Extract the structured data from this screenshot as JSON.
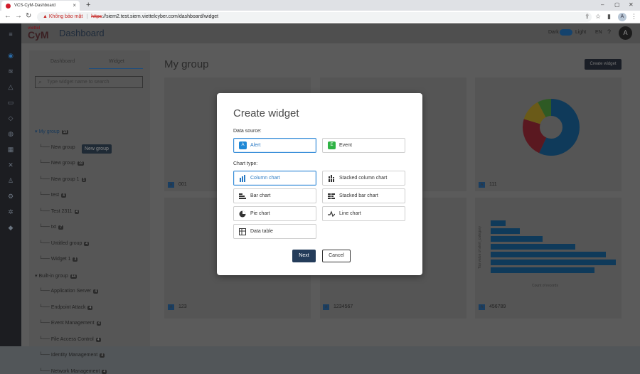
{
  "browser": {
    "tab_title": "VCS-CyM-Dashboard",
    "new_tab": "+",
    "address": {
      "warning": "Không bảo mật",
      "scheme": "https",
      "rest": "://siem2.test.siem.viettelcyber.com/dashboard/widget"
    },
    "profile_initial": "A"
  },
  "header": {
    "logo_small": "viettel",
    "logo_big": "CyM",
    "title": "Dashboard",
    "theme_dark": "Dark",
    "theme_light": "Light",
    "lang": "EN",
    "avatar_initial": "A"
  },
  "leftpanel": {
    "tabs": [
      "Dashboard",
      "Widget"
    ],
    "search_placeholder": "Type widget name to search",
    "tree": [
      {
        "label": "My group",
        "count": "10",
        "level": 0
      },
      {
        "label": "New group",
        "count": "",
        "level": 1
      },
      {
        "label": "New group",
        "count": "10",
        "level": 1
      },
      {
        "label": "New group 1",
        "count": "1",
        "level": 1
      },
      {
        "label": "test",
        "count": "4",
        "level": 1
      },
      {
        "label": "Test 2311",
        "count": "4",
        "level": 1
      },
      {
        "label": "txt",
        "count": "7",
        "level": 1
      },
      {
        "label": "Untitled group",
        "count": "4",
        "level": 1
      },
      {
        "label": "Widget 1",
        "count": "3",
        "level": 1
      },
      {
        "label": "Built-in group",
        "count": "44",
        "level": 0
      },
      {
        "label": "Application Server",
        "count": "4",
        "level": 1
      },
      {
        "label": "Endpoint Attack",
        "count": "4",
        "level": 1
      },
      {
        "label": "Event Management",
        "count": "4",
        "level": 1
      },
      {
        "label": "File Access Control",
        "count": "4",
        "level": 1
      },
      {
        "label": "Identity Management",
        "count": "4",
        "level": 1
      },
      {
        "label": "Network Management",
        "count": "4",
        "level": 1
      }
    ],
    "tooltip": "New group"
  },
  "main": {
    "title": "My group",
    "create_button": "Create widget",
    "cards": [
      {
        "badge": "A",
        "label": "001"
      },
      {
        "badge": "A",
        "label": "111"
      },
      {
        "badge": "A",
        "label": "123"
      },
      {
        "badge": "A",
        "label": "1234567"
      },
      {
        "badge": "A",
        "label": "456789"
      }
    ],
    "bar_axis_y": "Top value of alert_category",
    "bar_axis_x": "Count of records",
    "bar_values": [
      0.12,
      0.23,
      0.41,
      0.67,
      0.91,
      0.99,
      0.82
    ]
  },
  "modal": {
    "title": "Create widget",
    "data_source_label": "Data source:",
    "data_sources": [
      {
        "badge": "A",
        "label": "Alert",
        "color": "#1e88d6",
        "selected": true
      },
      {
        "badge": "E",
        "label": "Event",
        "color": "#2fb344",
        "selected": false
      }
    ],
    "chart_type_label": "Chart type:",
    "chart_types": [
      {
        "icon": "column-chart-icon",
        "label": "Column chart",
        "selected": true
      },
      {
        "icon": "stacked-column-chart-icon",
        "label": "Stacked column chart",
        "selected": false
      },
      {
        "icon": "bar-chart-icon",
        "label": "Bar chart",
        "selected": false
      },
      {
        "icon": "stacked-bar-chart-icon",
        "label": "Stacked bar chart",
        "selected": false
      },
      {
        "icon": "pie-chart-icon",
        "label": "Pie chart",
        "selected": false
      },
      {
        "icon": "line-chart-icon",
        "label": "Line chart",
        "selected": false
      },
      {
        "icon": "data-table-icon",
        "label": "Data table",
        "selected": false
      }
    ],
    "next_label": "Next",
    "cancel_label": "Cancel"
  }
}
